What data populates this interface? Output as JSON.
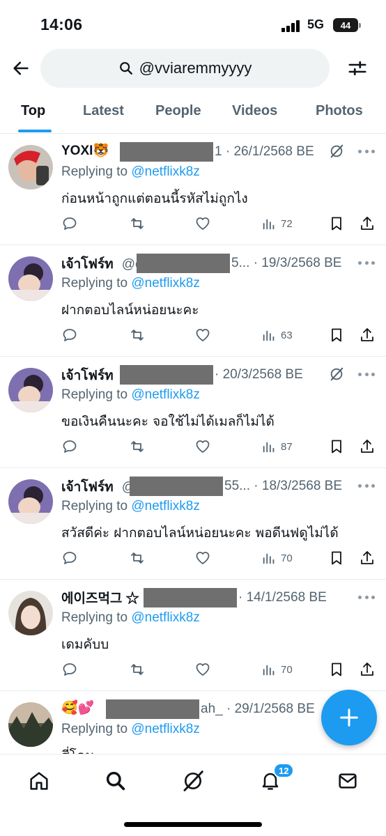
{
  "status_bar": {
    "time": "14:06",
    "network": "5G",
    "battery": "44"
  },
  "search": {
    "query": "@vviaremmyyyy"
  },
  "tabs": [
    {
      "label": "Top",
      "active": true
    },
    {
      "label": "Latest"
    },
    {
      "label": "People"
    },
    {
      "label": "Videos"
    },
    {
      "label": "Photos"
    }
  ],
  "tweets": [
    {
      "name": "YOXI🐯",
      "handle_visible": "1",
      "date": "· 26/1/2568 BE",
      "reply_prefix": "Replying to ",
      "reply_to": "@netflixk8z",
      "text": "ก่อนหน้าถูกแต่ตอนนี้รหัสไม่ถูกไง",
      "views": "72",
      "grok": true
    },
    {
      "name": "เจ้าโฟร์ท",
      "handle_visible": "@c",
      "handle_tail": "5...",
      "date": "· 19/3/2568 BE",
      "reply_prefix": "Replying to ",
      "reply_to": "@netflixk8z",
      "text": "ฝากตอบไลน์หน่อยนะคะ",
      "views": "63",
      "grok": false
    },
    {
      "name": "เจ้าโฟร์ท",
      "handle_visible": "",
      "date": "· 20/3/2568 BE",
      "reply_prefix": "Replying to ",
      "reply_to": "@netflixk8z",
      "text": "ขอเงินคืนนะคะ จอใช้ไม่ได้เมลก็ไม่ได้",
      "views": "87",
      "grok": true
    },
    {
      "name": "เจ้าโฟร์ท",
      "handle_visible": "@",
      "handle_tail": "55...",
      "date": "· 18/3/2568 BE",
      "reply_prefix": "Replying to ",
      "reply_to": "@netflixk8z",
      "text": "สวัสดีค่ะ ฝากตอบไลน์หน่อยนะคะ พอดีนฟดูไม่ได้",
      "views": "70",
      "grok": false
    },
    {
      "name": "에이즈먹그 ☆",
      "handle_visible": "",
      "date": "· 14/1/2568 BE",
      "reply_prefix": "Replying to ",
      "reply_to": "@netflixk8z",
      "text": "เดมคับบ",
      "views": "70",
      "grok": false
    },
    {
      "name": "🥰💕",
      "handle_visible": "",
      "handle_tail": "ah_",
      "date": "· 29/1/2568 BE",
      "reply_prefix": "Replying to ",
      "reply_to": "@netflixk8z",
      "text": "สี่โคม",
      "views": "",
      "grok": false
    }
  ],
  "nav": {
    "notifications_count": "12"
  },
  "colors": {
    "accent": "#1d9bf0",
    "muted": "#536471",
    "text": "#0f1419"
  },
  "icons": {
    "back": "arrow-left-icon",
    "search": "search-icon",
    "filter": "sliders-icon",
    "reply": "reply-icon",
    "retweet": "retweet-icon",
    "like": "heart-icon",
    "views": "views-icon",
    "bookmark": "bookmark-icon",
    "share": "share-icon",
    "grok": "grok-icon",
    "more": "more-icon",
    "compose": "plus-icon",
    "home": "home-icon",
    "explore": "search-icon",
    "grok_nav": "grok-icon",
    "notifications": "bell-icon",
    "messages": "mail-icon"
  }
}
